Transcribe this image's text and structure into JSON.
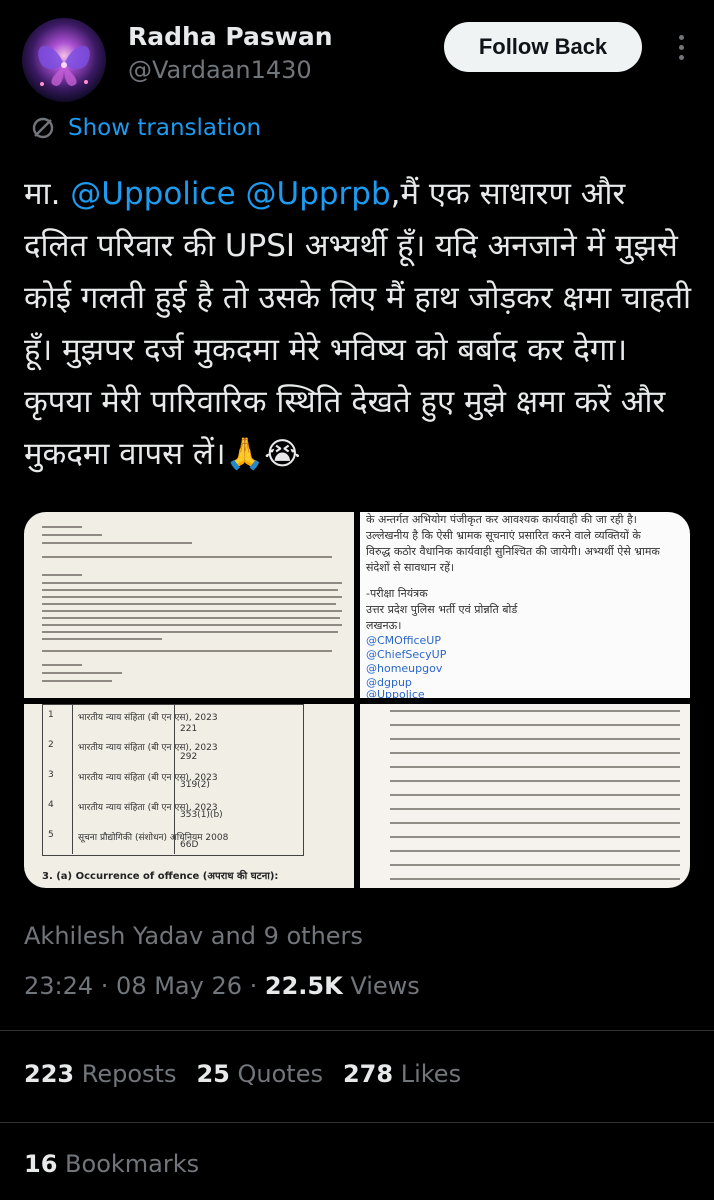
{
  "profile": {
    "name": "Radha Paswan",
    "handle": "@Vardaan1430",
    "follow_label": "Follow Back"
  },
  "translate_label": "Show translation",
  "tweet": {
    "prefix": "मा. ",
    "mention1": "@Uppolice",
    "mention2": "@Upprpb",
    "body": ",मैं एक साधारण और दलित परिवार की UPSI अभ्यर्थी हूँ। यदि अनजाने में मुझसे कोई गलती हुई है तो उसके लिए मैं हाथ जोड़कर क्षमा चाहती हूँ। मुझपर दर्ज मुकदमा मेरे भविष्य को बर्बाद कर देगा। कृपया मेरी पारिवारिक स्थिति देखते हुए मुझे क्षमा करें और मुकदमा वापस लें।🙏😭"
  },
  "media": {
    "image2_lines": [
      "के अन्तर्गत अभियोग पंजीकृत कर आवश्यक कार्यवाही की जा रही है।",
      "उल्लेखनीय है कि ऐसी भ्रामक सूचनाएं प्रसारित करने वाले व्यक्तियों के",
      "विरुद्ध कठोर वैधानिक कार्यवाही सुनिश्चित की जायेगी। अभ्यर्थी ऐसे भ्रामक",
      "संदेशों से सावधान रहें।",
      "-परीक्षा नियंत्रक",
      "उत्तर प्रदेश पुलिस भर्ती एवं प्रोन्नति बोर्ड",
      "लखनऊ।"
    ],
    "image2_links": [
      "@CMOfficeUP",
      "@ChiefSecyUP",
      "@homeupgov",
      "@dgpup",
      "@Uppolice"
    ],
    "image3_rows": [
      {
        "n": "1",
        "act": "भारतीय न्याय संहिता (बी एन एस), 2023",
        "sec": "221"
      },
      {
        "n": "2",
        "act": "भारतीय न्याय संहिता (बी एन एस), 2023",
        "sec": "292"
      },
      {
        "n": "3",
        "act": "भारतीय न्याय संहिता (बी एन एस), 2023",
        "sec": "319(2)"
      },
      {
        "n": "4",
        "act": "भारतीय न्याय संहिता (बी एन एस), 2023",
        "sec": "353(1)(b)"
      },
      {
        "n": "5",
        "act": "सूचना प्रौद्योगिकी (संशोधन) अधिनियम 2008",
        "sec": "66D"
      }
    ],
    "image3_footer": "3. (a) Occurrence of offence (अपराध की घटना):"
  },
  "liked_by": "Akhilesh Yadav and 9 others",
  "meta": {
    "time": "23:24 · 08 May 26 · ",
    "views_count": "22.5K",
    "views_label": " Views"
  },
  "stats": {
    "reposts_count": "223",
    "reposts_label": "Reposts",
    "quotes_count": "25",
    "quotes_label": "Quotes",
    "likes_count": "278",
    "likes_label": "Likes"
  },
  "bookmarks": {
    "count": "16",
    "label": "Bookmarks"
  },
  "colors": {
    "background": "#000000",
    "accent": "#1d9bf0",
    "muted": "#71767b",
    "text": "#e7e9ea"
  }
}
